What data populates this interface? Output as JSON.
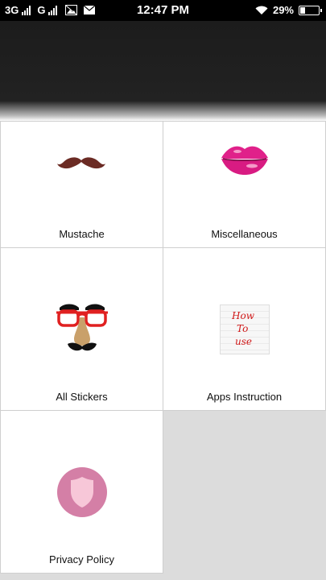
{
  "status_bar": {
    "network_1": "3G",
    "network_2": "G",
    "time": "12:47 PM",
    "battery": "29%",
    "battery_level": 0.29,
    "icons": [
      "signal-icon",
      "signal-icon",
      "photo-icon",
      "mail-icon",
      "wifi-icon",
      "battery-icon"
    ]
  },
  "menu": {
    "items": [
      {
        "label": "Mustache",
        "icon": "mustache-icon"
      },
      {
        "label": "Miscellaneous",
        "icon": "lips-icon"
      },
      {
        "label": "All Stickers",
        "icon": "glasses-nose-disguise-icon"
      },
      {
        "label": "Apps Instruction",
        "icon": "how-to-use-note-icon",
        "icon_text": [
          "How",
          "To",
          "use"
        ]
      },
      {
        "label": "Privacy Policy",
        "icon": "shield-icon"
      }
    ]
  },
  "colors": {
    "header": "#1c1c1c",
    "lips": "#e0218a",
    "mustache": "#6b2b24",
    "glasses": "#e02020",
    "shield_circle": "#d47fa6",
    "note_text": "#d01818"
  }
}
